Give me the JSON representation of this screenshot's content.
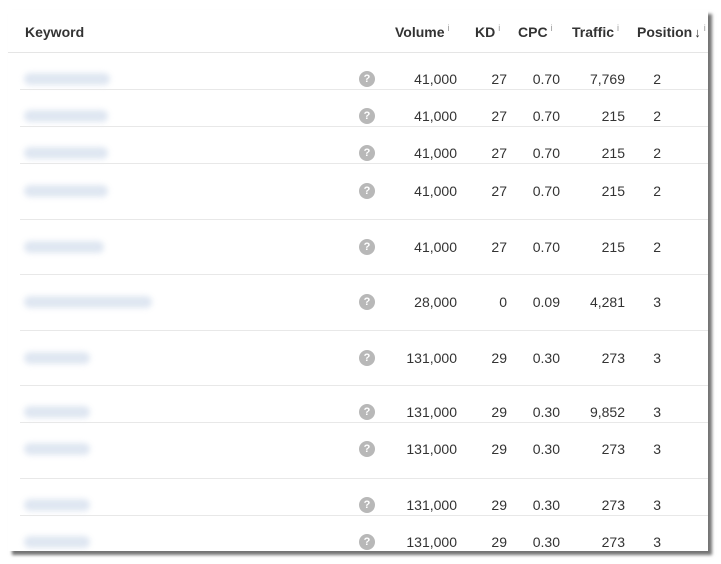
{
  "header": {
    "keyword": "Keyword",
    "volume": "Volume",
    "kd": "KD",
    "cpc": "CPC",
    "traffic": "Traffic",
    "position": "Position",
    "info_mark": "i",
    "sort_arrow": "↓"
  },
  "help_glyph": "?",
  "rows": [
    {
      "volume": "41,000",
      "kd": "27",
      "cpc": "0.70",
      "traffic": "7,769",
      "position": "2"
    },
    {
      "volume": "41,000",
      "kd": "27",
      "cpc": "0.70",
      "traffic": "215",
      "position": "2"
    },
    {
      "volume": "41,000",
      "kd": "27",
      "cpc": "0.70",
      "traffic": "215",
      "position": "2"
    },
    {
      "volume": "41,000",
      "kd": "27",
      "cpc": "0.70",
      "traffic": "215",
      "position": "2"
    },
    {
      "volume": "41,000",
      "kd": "27",
      "cpc": "0.70",
      "traffic": "215",
      "position": "2"
    },
    {
      "volume": "28,000",
      "kd": "0",
      "cpc": "0.09",
      "traffic": "4,281",
      "position": "3"
    },
    {
      "volume": "131,000",
      "kd": "29",
      "cpc": "0.30",
      "traffic": "273",
      "position": "3"
    },
    {
      "volume": "131,000",
      "kd": "29",
      "cpc": "0.30",
      "traffic": "9,852",
      "position": "3"
    },
    {
      "volume": "131,000",
      "kd": "29",
      "cpc": "0.30",
      "traffic": "273",
      "position": "3"
    },
    {
      "volume": "131,000",
      "kd": "29",
      "cpc": "0.30",
      "traffic": "273",
      "position": "3"
    },
    {
      "volume": "131,000",
      "kd": "29",
      "cpc": "0.30",
      "traffic": "273",
      "position": "3"
    }
  ]
}
